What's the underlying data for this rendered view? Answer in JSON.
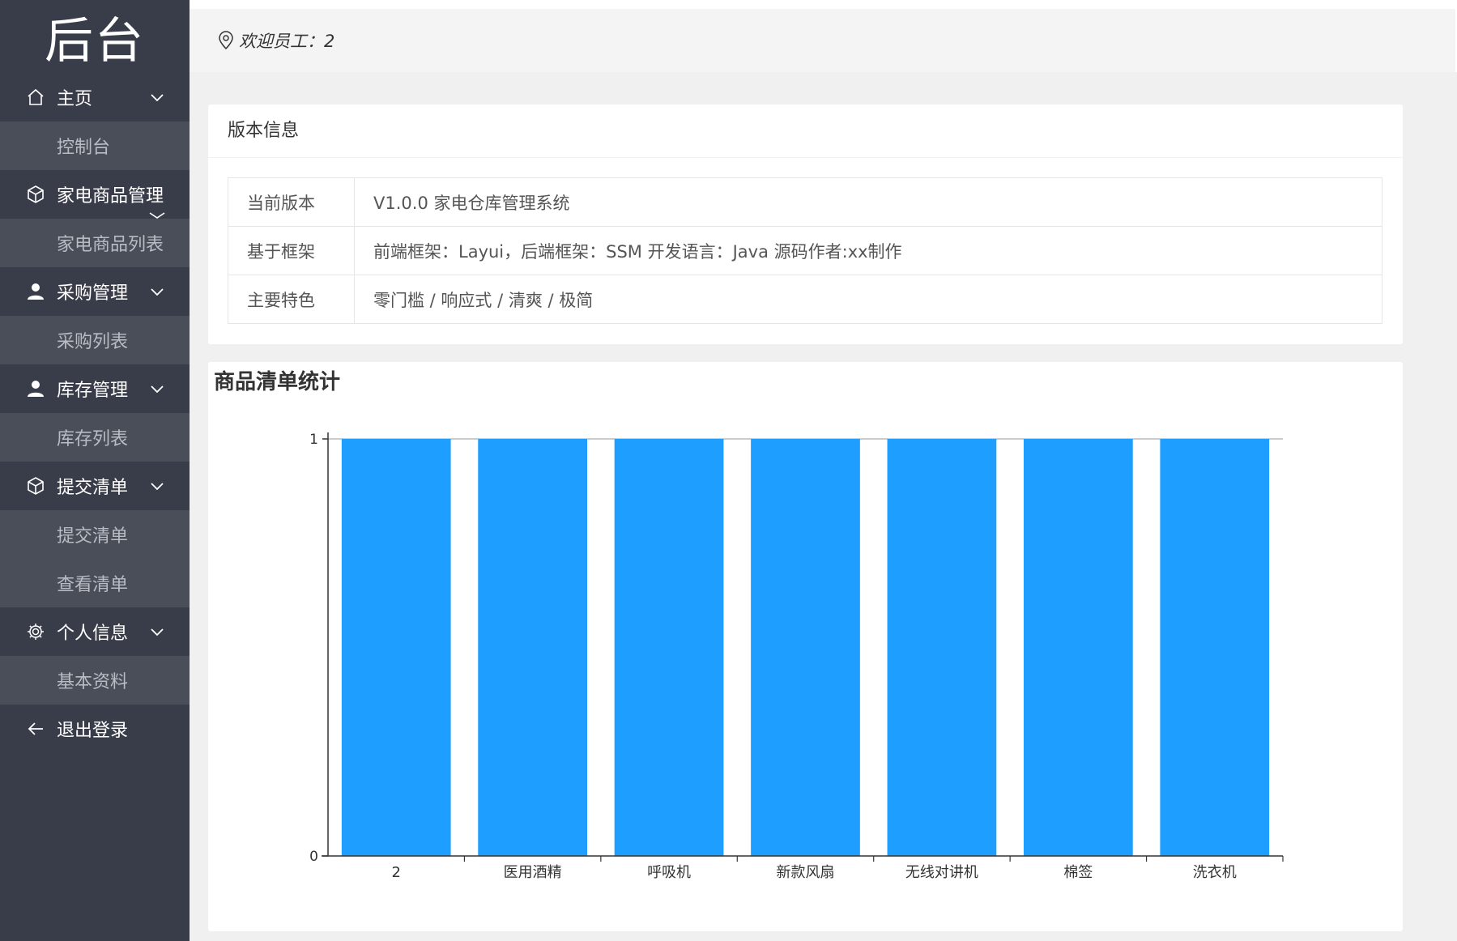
{
  "sidebar": {
    "logo": "后台",
    "groups": [
      {
        "label": "主页",
        "icon": "home-icon",
        "children": [
          "控制台"
        ]
      },
      {
        "label": "家电商品管理",
        "icon": "cube-icon",
        "children": [
          "家电商品列表"
        ]
      },
      {
        "label": "采购管理",
        "icon": "user-icon",
        "children": [
          "采购列表"
        ]
      },
      {
        "label": "库存管理",
        "icon": "user-icon",
        "children": [
          "库存列表"
        ]
      },
      {
        "label": "提交清单",
        "icon": "cube-icon",
        "children": [
          "提交清单",
          "查看清单"
        ]
      },
      {
        "label": "个人信息",
        "icon": "gear-icon",
        "children": [
          "基本资料"
        ]
      }
    ],
    "logout": {
      "label": "退出登录",
      "icon": "arrow-left-icon"
    }
  },
  "header": {
    "welcome": "欢迎员工：2",
    "icon": "location-pin-icon"
  },
  "version_card": {
    "title": "版本信息",
    "rows": [
      {
        "key": "当前版本",
        "value": "V1.0.0 家电仓库管理系统"
      },
      {
        "key": "基于框架",
        "value": "前端框架：Layui，后端框架：SSM 开发语言：Java 源码作者:xx制作"
      },
      {
        "key": "主要特色",
        "value": "零门槛 / 响应式 / 清爽 / 极简"
      }
    ]
  },
  "chart_card": {
    "title": "商品清单统计"
  },
  "chart_data": {
    "type": "bar",
    "title": "商品清单统计",
    "categories": [
      "2",
      "医用酒精",
      "呼吸机",
      "新款风扇",
      "无线对讲机",
      "棉签",
      "洗衣机"
    ],
    "values": [
      1,
      1,
      1,
      1,
      1,
      1,
      1
    ],
    "ylim": [
      0,
      1
    ],
    "yticks": [
      "0",
      "1"
    ],
    "color": "#1e9fff",
    "grid": false
  },
  "colors": {
    "sidebar_bg": "#393d49",
    "bar": "#1e9fff"
  }
}
